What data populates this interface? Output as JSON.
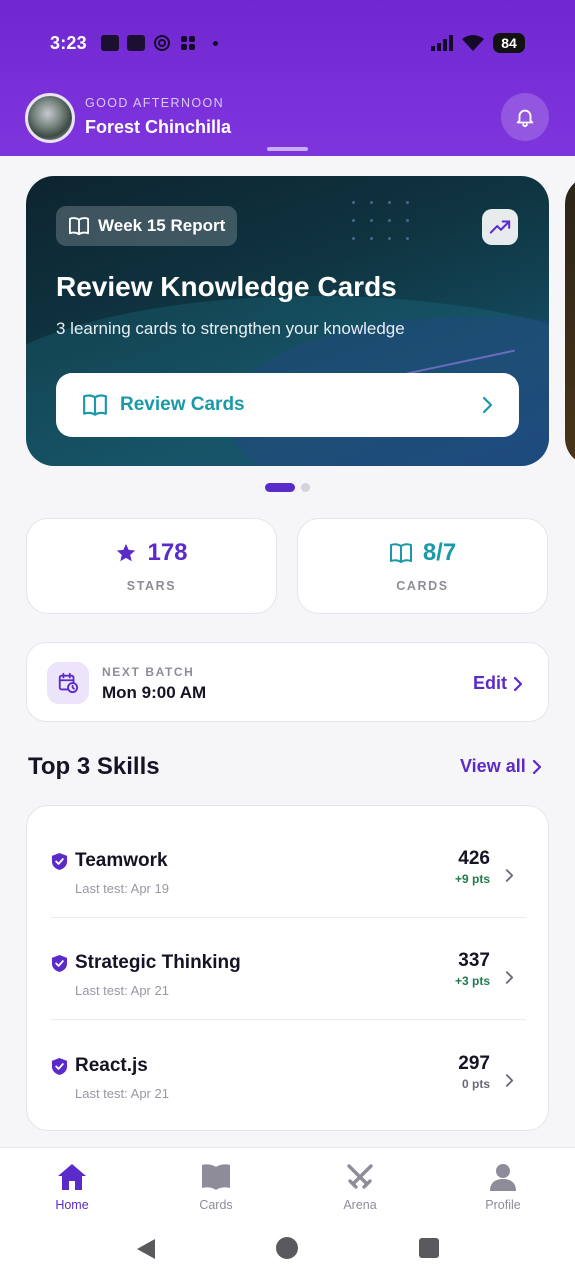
{
  "status_bar": {
    "time": "3:23",
    "battery": "84"
  },
  "header": {
    "greeting": "GOOD AFTERNOON",
    "user_name": "Forest Chinchilla"
  },
  "banner": {
    "chip_label": "Week 15 Report",
    "title": "Review Knowledge Cards",
    "subtitle": "3 learning cards to strengthen your knowledge",
    "button_label": "Review Cards",
    "page_count": 2,
    "active_page": 1
  },
  "stats": {
    "stars": {
      "value": "178",
      "label": "STARS"
    },
    "cards": {
      "value": "8/7",
      "label": "CARDS"
    }
  },
  "next_batch": {
    "label": "NEXT BATCH",
    "value": "Mon 9:00 AM",
    "action": "Edit"
  },
  "skills": {
    "title": "Top 3 Skills",
    "view_all": "View all",
    "items": [
      {
        "name": "Teamwork",
        "date": "Last test: Apr 19",
        "score": "426",
        "delta": "+9 pts",
        "delta_color": "#1f7a4f"
      },
      {
        "name": "Strategic Thinking",
        "date": "Last test: Apr 21",
        "score": "337",
        "delta": "+3 pts",
        "delta_color": "#1f7a4f"
      },
      {
        "name": "React.js",
        "date": "Last test: Apr 21",
        "score": "297",
        "delta": "0 pts",
        "delta_color": "#6b6875"
      }
    ]
  },
  "nav": {
    "items": [
      {
        "label": "Home",
        "icon": "home-icon",
        "active": true
      },
      {
        "label": "Cards",
        "icon": "book-icon",
        "active": false
      },
      {
        "label": "Arena",
        "icon": "swords-icon",
        "active": false
      },
      {
        "label": "Profile",
        "icon": "person-icon",
        "active": false
      }
    ]
  },
  "colors": {
    "primary": "#5b2bc9",
    "header_bg": "#7a30d9",
    "teal": "#1a9aa8",
    "positive": "#1f7a4f"
  }
}
